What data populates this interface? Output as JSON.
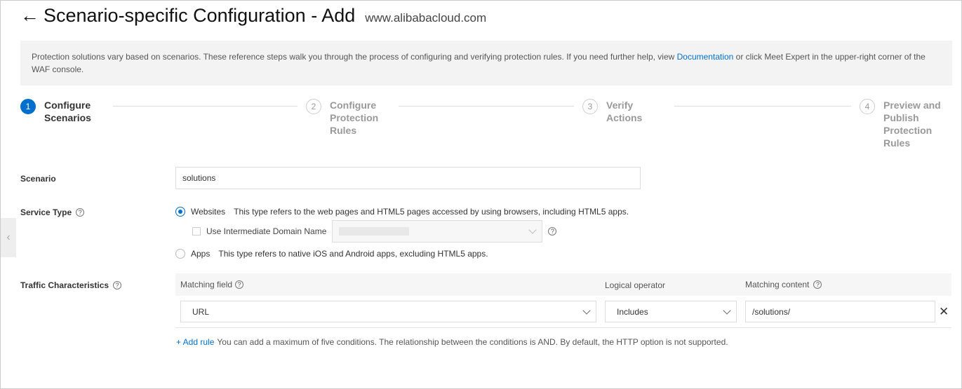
{
  "header": {
    "back_icon": "arrow-left-icon",
    "title": "Scenario-specific Configuration - Add",
    "domain": "www.alibabacloud.com"
  },
  "notice": {
    "text_before": "Protection solutions vary based on scenarios. These reference steps walk you through the process of configuring and verifying protection rules. If you need further help, view ",
    "link": "Documentation",
    "text_after": " or click Meet Expert in the upper-right corner of the WAF console."
  },
  "steps": [
    {
      "num": "1",
      "label": "Configure Scenarios",
      "active": true
    },
    {
      "num": "2",
      "label": "Configure Protection Rules",
      "active": false
    },
    {
      "num": "3",
      "label": "Verify Actions",
      "active": false
    },
    {
      "num": "4",
      "label": "Preview and Publish Protection Rules",
      "active": false
    }
  ],
  "form": {
    "scenario_label": "Scenario",
    "scenario_value": "solutions",
    "service_type_label": "Service Type",
    "websites_label": "Websites",
    "websites_desc": "This type refers to the web pages and HTML5 pages accessed by using browsers, including HTML5 apps.",
    "intermediate_label": "Use Intermediate Domain Name",
    "apps_label": "Apps",
    "apps_desc": "This type refers to native iOS and Android apps, excluding HTML5 apps.",
    "selected_service": "Websites",
    "traffic_label": "Traffic Characteristics",
    "columns": [
      "Matching field",
      "Logical operator",
      "Matching content"
    ],
    "rule": {
      "field": "URL",
      "operator": "Includes",
      "content": "/solutions/"
    },
    "add_rule": "+ Add rule",
    "add_rule_hint": "You can add a maximum of five conditions. The relationship between the conditions is AND. By default, the HTTP option is not supported."
  },
  "colors": {
    "accent": "#0070cc"
  }
}
